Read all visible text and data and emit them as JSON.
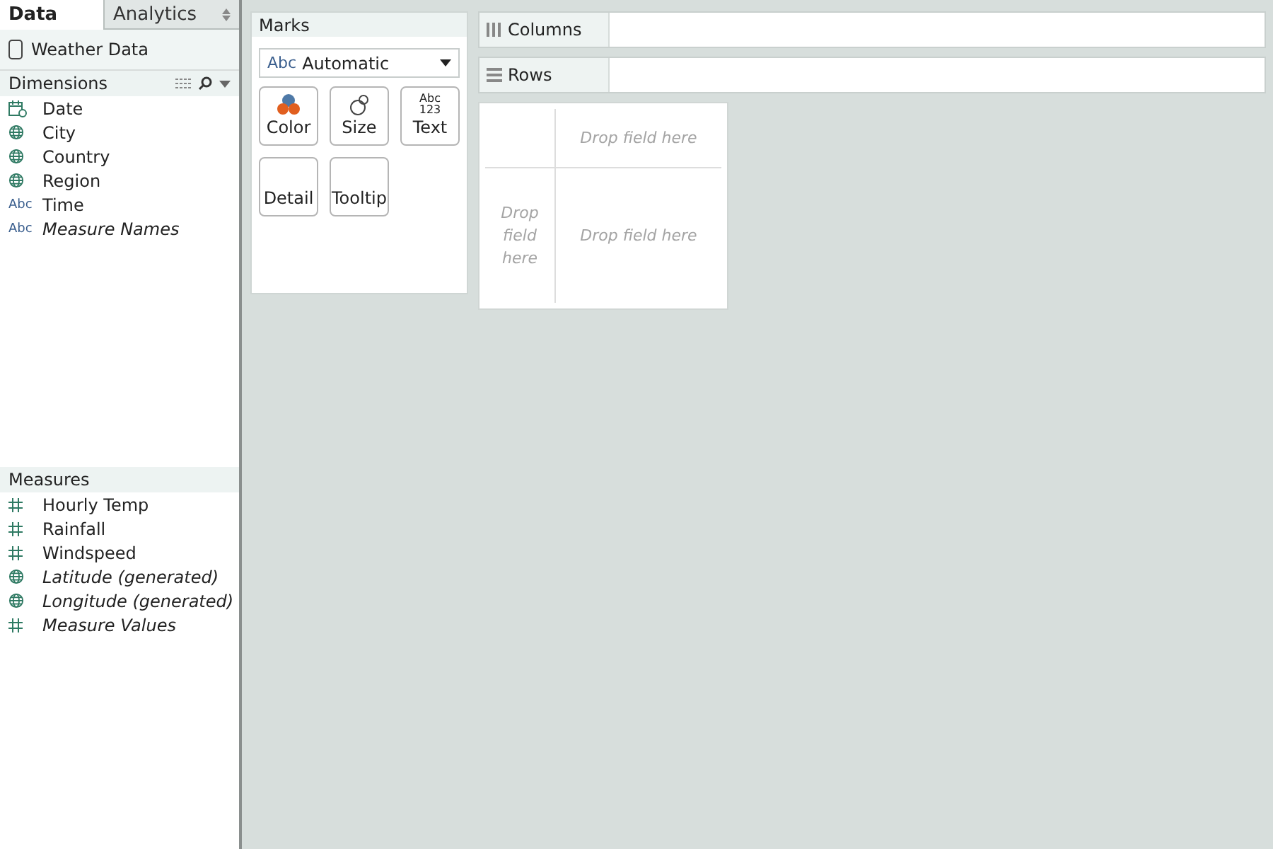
{
  "tabs": [
    {
      "label": "Data",
      "selected": true
    },
    {
      "label": "Analytics",
      "selected": false
    }
  ],
  "datasource": "Weather Data",
  "dimensions": {
    "title": "Dimensions",
    "fields": [
      {
        "kind": "date",
        "name": "Date",
        "italic": false
      },
      {
        "kind": "geo",
        "name": "City",
        "italic": false
      },
      {
        "kind": "geo",
        "name": "Country",
        "italic": false
      },
      {
        "kind": "geo",
        "name": "Region",
        "italic": false
      },
      {
        "kind": "string",
        "type_text": "Abc",
        "name": "Time",
        "italic": false
      },
      {
        "kind": "string",
        "type_text": "Abc",
        "name": "Measure Names",
        "italic": true
      }
    ]
  },
  "measures": {
    "title": "Measures",
    "fields": [
      {
        "kind": "number",
        "name": "Hourly Temp",
        "italic": false
      },
      {
        "kind": "number",
        "name": "Rainfall",
        "italic": false
      },
      {
        "kind": "number",
        "name": "Windspeed",
        "italic": false
      },
      {
        "kind": "geo",
        "name": "Latitude (generated)",
        "italic": true
      },
      {
        "kind": "geo",
        "name": "Longitude (generated)",
        "italic": true
      },
      {
        "kind": "number",
        "name": "Measure Values",
        "italic": true
      }
    ]
  },
  "marks": {
    "title": "Marks",
    "type_text": "Abc",
    "mark_type": "Automatic",
    "buttons": [
      {
        "kind": "color",
        "label": "Color"
      },
      {
        "kind": "size",
        "label": "Size"
      },
      {
        "kind": "text",
        "icon_text": [
          "Abc",
          "123"
        ],
        "label": "Text"
      },
      {
        "kind": "plain",
        "label": "Detail"
      },
      {
        "kind": "plain",
        "label": "Tooltip"
      }
    ]
  },
  "shelves": [
    {
      "kind": "columns",
      "label": "Columns"
    },
    {
      "kind": "rows",
      "label": "Rows"
    }
  ],
  "drop_zones": {
    "top": "Drop field here",
    "left": "Drop\nfield\nhere",
    "center": "Drop field here"
  }
}
